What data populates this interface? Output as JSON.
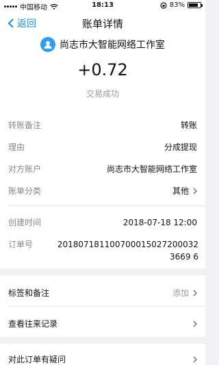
{
  "status_bar": {
    "carrier": "中国移动",
    "time": "18:13",
    "battery_text": "83%",
    "battery_level": 0.83
  },
  "nav": {
    "back_label": "返回",
    "title": "账单详情"
  },
  "hero": {
    "merchant": "尚志市大智能网络工作室",
    "amount": "+0.72",
    "status": "交易成功"
  },
  "details": {
    "rows": [
      {
        "label": "转账备注",
        "value": "转账"
      },
      {
        "label": "理由",
        "value": "分成提现"
      },
      {
        "label": "对方账户",
        "value": "尚志市大智能网络工作室"
      },
      {
        "label": "账单分类",
        "value": "其他"
      },
      {
        "label": "创建时间",
        "value": "2018-07-18 12:00"
      }
    ],
    "order_label": "订单号",
    "order_value": "2018071811007000150272000323669 6"
  },
  "actions": {
    "tags_label": "标签和备注",
    "tags_action": "添加",
    "history_label": "查看往来记录",
    "question_label": "对此订单有疑问"
  },
  "colors": {
    "accent": "#108ee9",
    "avatar": "#2e9df3"
  }
}
